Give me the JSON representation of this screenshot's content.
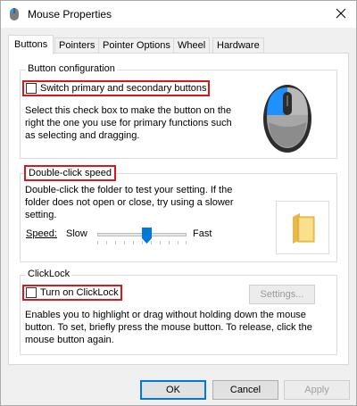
{
  "window": {
    "title": "Mouse Properties"
  },
  "tabs": [
    {
      "label": "Buttons",
      "active": true
    },
    {
      "label": "Pointers"
    },
    {
      "label": "Pointer Options"
    },
    {
      "label": "Wheel"
    },
    {
      "label": "Hardware"
    }
  ],
  "button_config": {
    "group_label": "Button configuration",
    "checkbox_label": "Switch primary and secondary buttons",
    "checked": false,
    "description_lines": [
      "Select this check box to make the button on the",
      "right the one you use for primary functions such",
      "as selecting and dragging."
    ]
  },
  "double_click": {
    "group_label": "Double-click speed",
    "description_lines": [
      "Double-click the folder to test your setting. If the",
      "folder does not open or close, try using a slower",
      "setting."
    ],
    "speed_label": "Speed:",
    "slow_label": "Slow",
    "fast_label": "Fast",
    "slider_value_fraction": 0.55
  },
  "clicklock": {
    "group_label": "ClickLock",
    "checkbox_label": "Turn on ClickLock",
    "checked": false,
    "settings_button": "Settings...",
    "description_lines": [
      "Enables you to highlight or drag without holding down the mouse",
      "button. To set, briefly press the mouse button. To release, click the",
      "mouse button again."
    ]
  },
  "dialog_buttons": {
    "ok": "OK",
    "cancel": "Cancel",
    "apply": "Apply"
  },
  "colors": {
    "highlight_box": "#d7191c",
    "mouse_accent": "#1e90ff",
    "default_button_border": "#0078d7"
  },
  "icons": {
    "title": "mouse-icon",
    "close": "close-icon",
    "folder": "folder-icon",
    "mouse_illustration": "mouse-illustration-icon"
  }
}
